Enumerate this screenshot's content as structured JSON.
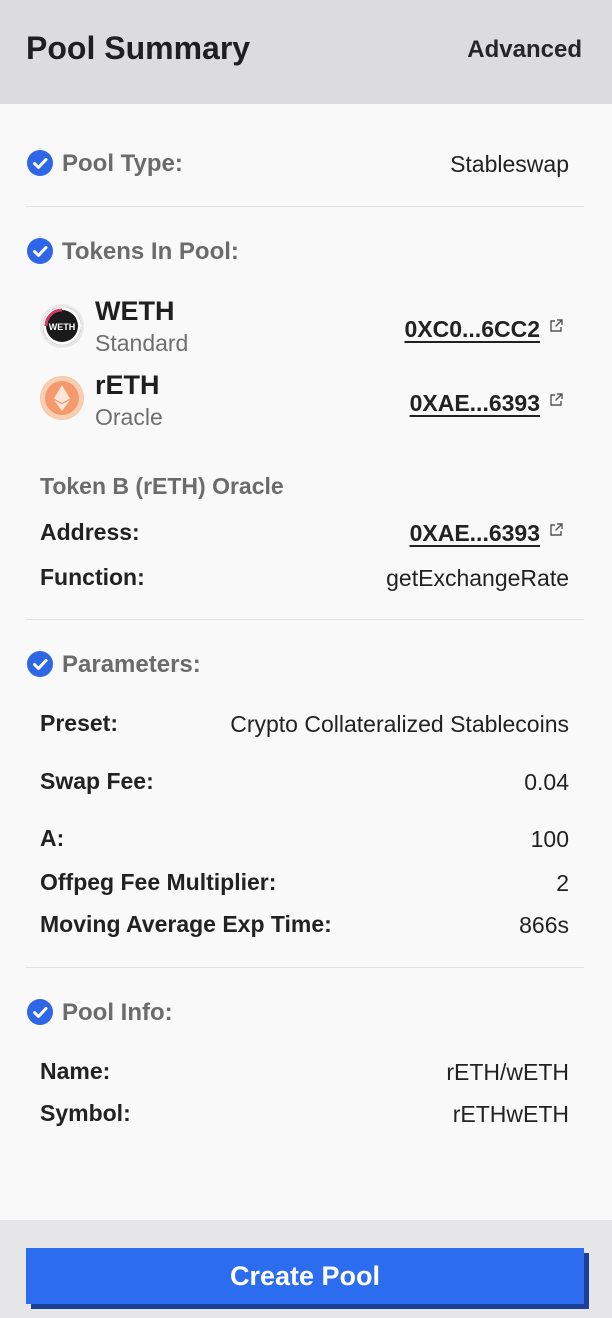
{
  "header": {
    "title": "Pool Summary",
    "advanced_label": "Advanced"
  },
  "pool_type": {
    "label": "Pool Type:",
    "value": "Stableswap"
  },
  "tokens": {
    "title": "Tokens In Pool:",
    "items": [
      {
        "symbol": "WETH",
        "type": "Standard",
        "address": "0XC0...6CC2",
        "logo_text": "WETH",
        "icon": "weth-logo-icon"
      },
      {
        "symbol": "rETH",
        "type": "Oracle",
        "address": "0XAE...6393",
        "icon": "reth-logo-icon"
      }
    ],
    "oracle": {
      "title": "Token B (rETH) Oracle",
      "address_label": "Address:",
      "address_value": "0XAE...6393",
      "function_label": "Function:",
      "function_value": "getExchangeRate"
    }
  },
  "parameters": {
    "title": "Parameters:",
    "rows": [
      {
        "label": "Preset:",
        "value": "Crypto Collateralized Stablecoins"
      },
      {
        "label": "Swap Fee:",
        "value": "0.04"
      },
      {
        "label": "A:",
        "value": "100"
      },
      {
        "label": "Offpeg Fee Multiplier:",
        "value": "2"
      },
      {
        "label": "Moving Average Exp Time:",
        "value": "866s"
      }
    ]
  },
  "pool_info": {
    "title": "Pool Info:",
    "name_label": "Name:",
    "name_value": "rETH/wETH",
    "symbol_label": "Symbol:",
    "symbol_value": "rETHwETH"
  },
  "footer": {
    "create_label": "Create Pool"
  },
  "colors": {
    "accent": "#2c6df0",
    "check": "#2f66e8",
    "header_bg": "#dcdcde",
    "panel_bg": "#f9f9f9"
  }
}
